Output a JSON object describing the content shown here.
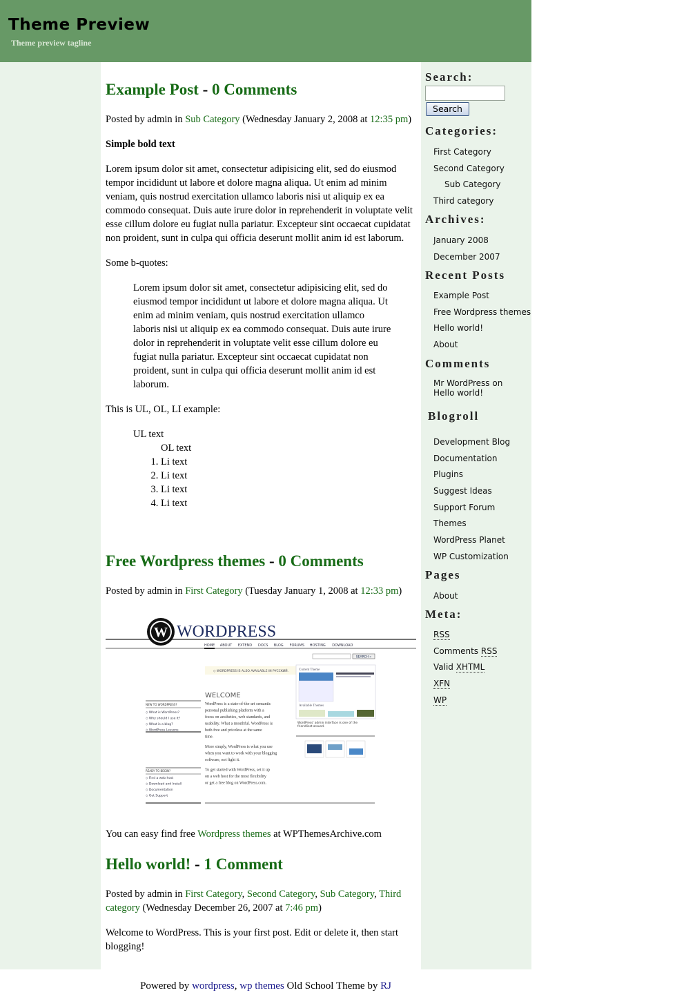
{
  "header": {
    "title": "Theme Preview",
    "tagline": "Theme preview tagline"
  },
  "colors": {
    "header_bg": "#679966",
    "column_bg": "#eaf3ea",
    "link_green": "#176b16",
    "footer_link": "#1a1a8c"
  },
  "posts": [
    {
      "title": "Example Post",
      "separator": " - ",
      "comments": "0 Comments",
      "meta_prefix": "Posted by admin in ",
      "categories": [
        "Sub Category"
      ],
      "date_text": " (Wednesday January 2, 2008 at ",
      "time": "12:35 pm",
      "meta_suffix": ")",
      "bold_text": "Simple bold text",
      "paragraph": "Lorem ipsum dolor sit amet, consectetur adipisicing elit, sed do eiusmod tempor incididunt ut labore et dolore magna aliqua. Ut enim ad minim veniam, quis nostrud exercitation ullamco laboris nisi ut aliquip ex ea commodo consequat. Duis aute irure dolor in reprehenderit in voluptate velit esse cillum dolore eu fugiat nulla pariatur. Excepteur sint occaecat cupidatat non proident, sunt in culpa qui officia deserunt mollit anim id est laborum.",
      "bquote_label": "Some b-quotes:",
      "blockquote": "Lorem ipsum dolor sit amet, consectetur adipisicing elit, sed do eiusmod tempor incididunt ut labore et dolore magna aliqua. Ut enim ad minim veniam, quis nostrud exercitation ullamco laboris nisi ut aliquip ex ea commodo consequat. Duis aute irure dolor in reprehenderit in voluptate velit esse cillum dolore eu fugiat nulla pariatur. Excepteur sint occaecat cupidatat non proident, sunt in culpa qui officia deserunt mollit anim id est laborum.",
      "list_label": "This is UL, OL, LI example:",
      "ul_text": "UL text",
      "ol_text": "OL text",
      "li_items": [
        "Li text",
        "Li text",
        "Li text",
        "Li text"
      ]
    },
    {
      "title": "Free Wordpress themes",
      "separator": " - ",
      "comments": "0 Comments",
      "meta_prefix": "Posted by admin in ",
      "categories": [
        "First Category"
      ],
      "date_text": " (Tuesday January 1, 2008 at ",
      "time": "12:33 pm",
      "meta_suffix": ")",
      "body_prefix": "You can easy find free ",
      "body_link": "Wordpress themes",
      "body_suffix": " at WPThemesArchive.com",
      "screenshot": {
        "logo_text": "WordPress",
        "nav": [
          "HOME",
          "ABOUT",
          "EXTEND",
          "DOCS",
          "BLOG",
          "FORUMS",
          "HOSTING",
          "DOWNLOAD"
        ],
        "search_button": "SEARCH »",
        "notice": "WORDPRESS IS ALSO AVAILABLE IN РУССКИЙ.",
        "welcome": "WELCOME",
        "new_heading": "NEW TO WORDPRESS?",
        "new_links": [
          "What is WordPress?",
          "Why should I use it?",
          "What is a blog?",
          "WordPress Lessons"
        ],
        "ready_heading": "READY TO BEGIN?",
        "ready_links": [
          "Find a web host",
          "Download and Install",
          "Documentation",
          "Get Support"
        ],
        "intro_bold": "WordPress is",
        "intro": " a state-of-the-art semantic personal publishing platform with a focus on aesthetics, web standards, and usability. What a mouthful. WordPress is both free and priceless at the same time.",
        "para2": "More simply, WordPress is what you use when you want to work with your blogging software, not fight it.",
        "para3_prefix": "To get started with WordPress, ",
        "para3_link1": "set it up on a web host",
        "para3_mid": " for the most flexibility or ",
        "para3_link2": "get a free blog on WordPress.com",
        "para3_suffix": ".",
        "current_theme": "Current Theme",
        "available_themes": "Available Themes",
        "caption": "WordPress' admin interface is one of the friendliest around."
      }
    },
    {
      "title": "Hello world!",
      "separator": " - ",
      "comments": "1 Comment",
      "meta_prefix": "Posted by admin in ",
      "categories": [
        "First Category",
        "Second Category",
        "Sub Category",
        "Third category"
      ],
      "date_text": " (Wednesday December 26, 2007 at ",
      "time": "7:46 pm",
      "meta_suffix": ")",
      "body": "Welcome to WordPress. This is your first post. Edit or delete it, then start blogging!"
    }
  ],
  "sidebar": {
    "search": {
      "heading": "Search:",
      "value": "",
      "placeholder": "",
      "button": "Search"
    },
    "categories": {
      "heading": "Categories:",
      "items": [
        "First Category",
        "Second Category",
        "Sub Category",
        "Third category"
      ]
    },
    "archives": {
      "heading": "Archives:",
      "items": [
        "January 2008",
        "December 2007"
      ]
    },
    "recent_posts": {
      "heading": "Recent Posts",
      "items": [
        "Example Post",
        "Free Wordpress themes",
        "Hello world!",
        "About"
      ]
    },
    "comments": {
      "heading": "Comments",
      "author": "Mr WordPress",
      "on": " on ",
      "post": "Hello world!"
    },
    "blogroll": {
      "heading": "Blogroll",
      "items": [
        "Development Blog",
        "Documentation",
        "Plugins",
        "Suggest Ideas",
        "Support Forum",
        "Themes",
        "WordPress Planet",
        "WP Customization"
      ]
    },
    "pages": {
      "heading": "Pages",
      "items": [
        "About"
      ]
    },
    "meta": {
      "heading": "Meta:",
      "rss": "RSS",
      "comments_prefix": "Comments ",
      "comments_rss": "RSS",
      "valid_prefix": "Valid ",
      "xhtml": "XHTML",
      "xfn": "XFN",
      "wp": "WP"
    }
  },
  "footer": {
    "prefix": "Powered by ",
    "link1": "wordpress",
    "comma": ", ",
    "link2": "wp themes",
    "middle": " Old School Theme by ",
    "link3": "RJ"
  }
}
